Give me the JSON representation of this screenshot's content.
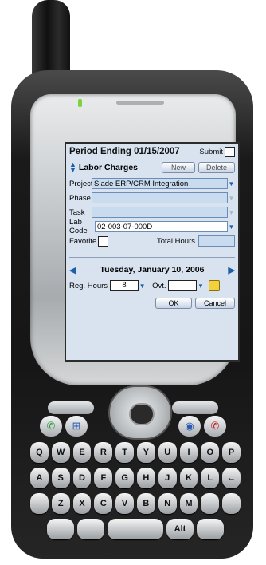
{
  "screen": {
    "title": "Period Ending 01/15/2007",
    "submit_label": "Submit",
    "section_title": "Labor Charges",
    "new_button": "New",
    "delete_button": "Delete",
    "fields": {
      "project_label": "Project",
      "project_value": "Slade ERP/CRM Integration",
      "phase_label": "Phase",
      "phase_value": "",
      "task_label": "Task",
      "task_value": "",
      "lab_code_label": "Lab Code",
      "lab_code_value": "02-003-07-000D",
      "favorite_label": "Favorite",
      "total_hours_label": "Total Hours",
      "total_hours_value": ""
    },
    "date": "Tuesday, January 10, 2006",
    "reg_hours_label": "Reg. Hours",
    "reg_hours_value": "8",
    "ovt_label": "Ovt.",
    "ovt_value": "",
    "ok_button": "OK",
    "cancel_button": "Cancel"
  },
  "keyboard": {
    "row1": [
      "Q",
      "W",
      "E",
      "R",
      "T",
      "Y",
      "U",
      "I",
      "O",
      "P"
    ],
    "row2": [
      "A",
      "S",
      "D",
      "F",
      "G",
      "H",
      "J",
      "K",
      "L",
      "←"
    ],
    "row3": [
      "",
      "Z",
      "X",
      "C",
      "V",
      "B",
      "N",
      "M",
      "",
      ""
    ],
    "row4_alt": "Alt"
  }
}
